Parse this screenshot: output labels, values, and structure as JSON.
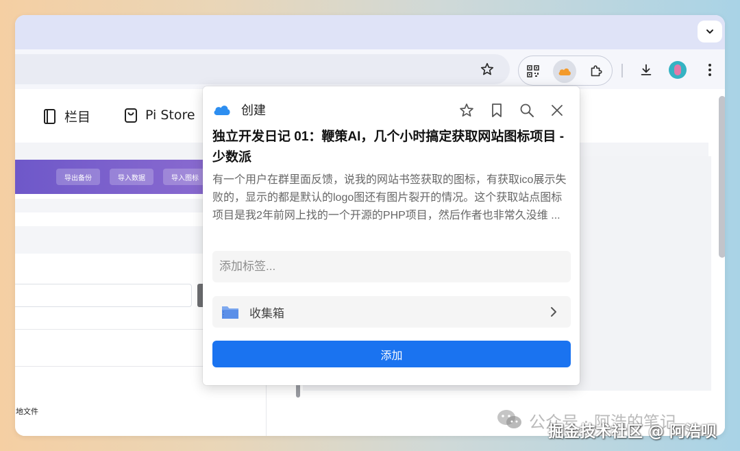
{
  "colors": {
    "accent": "#1a73f0",
    "purple_bar": "#7560cc",
    "tabstrip": "#dfe3f7"
  },
  "site_nav": {
    "items": [
      {
        "icon": "book-icon",
        "label": "栏目"
      },
      {
        "icon": "bag-icon",
        "label": "Pi Store"
      }
    ]
  },
  "toolbar_buttons": [
    "导出备份",
    "导入数据",
    "导入图标"
  ],
  "page_misc": {
    "file_label": "地文件"
  },
  "popup": {
    "header": "创建",
    "title": "独立开发日记 01：鞭策AI，几个小时搞定获取网站图标项目 - 少数派",
    "description": "有一个用户在群里面反馈，说我的网站书签获取的图标，有获取ico展示失败的，显示的都是默认的logo图还有图片裂开的情况。这个获取站点图标项目是我2年前网上找的一个开源的PHP项目，然后作者也非常久没维 ...",
    "tag_placeholder": "添加标签...",
    "folder": "收集箱",
    "add_button": "添加"
  },
  "watermark": {
    "faint": "公众号 · 阿浩的笔记",
    "strong": "掘金技术社区 @ 阿浩呗"
  }
}
